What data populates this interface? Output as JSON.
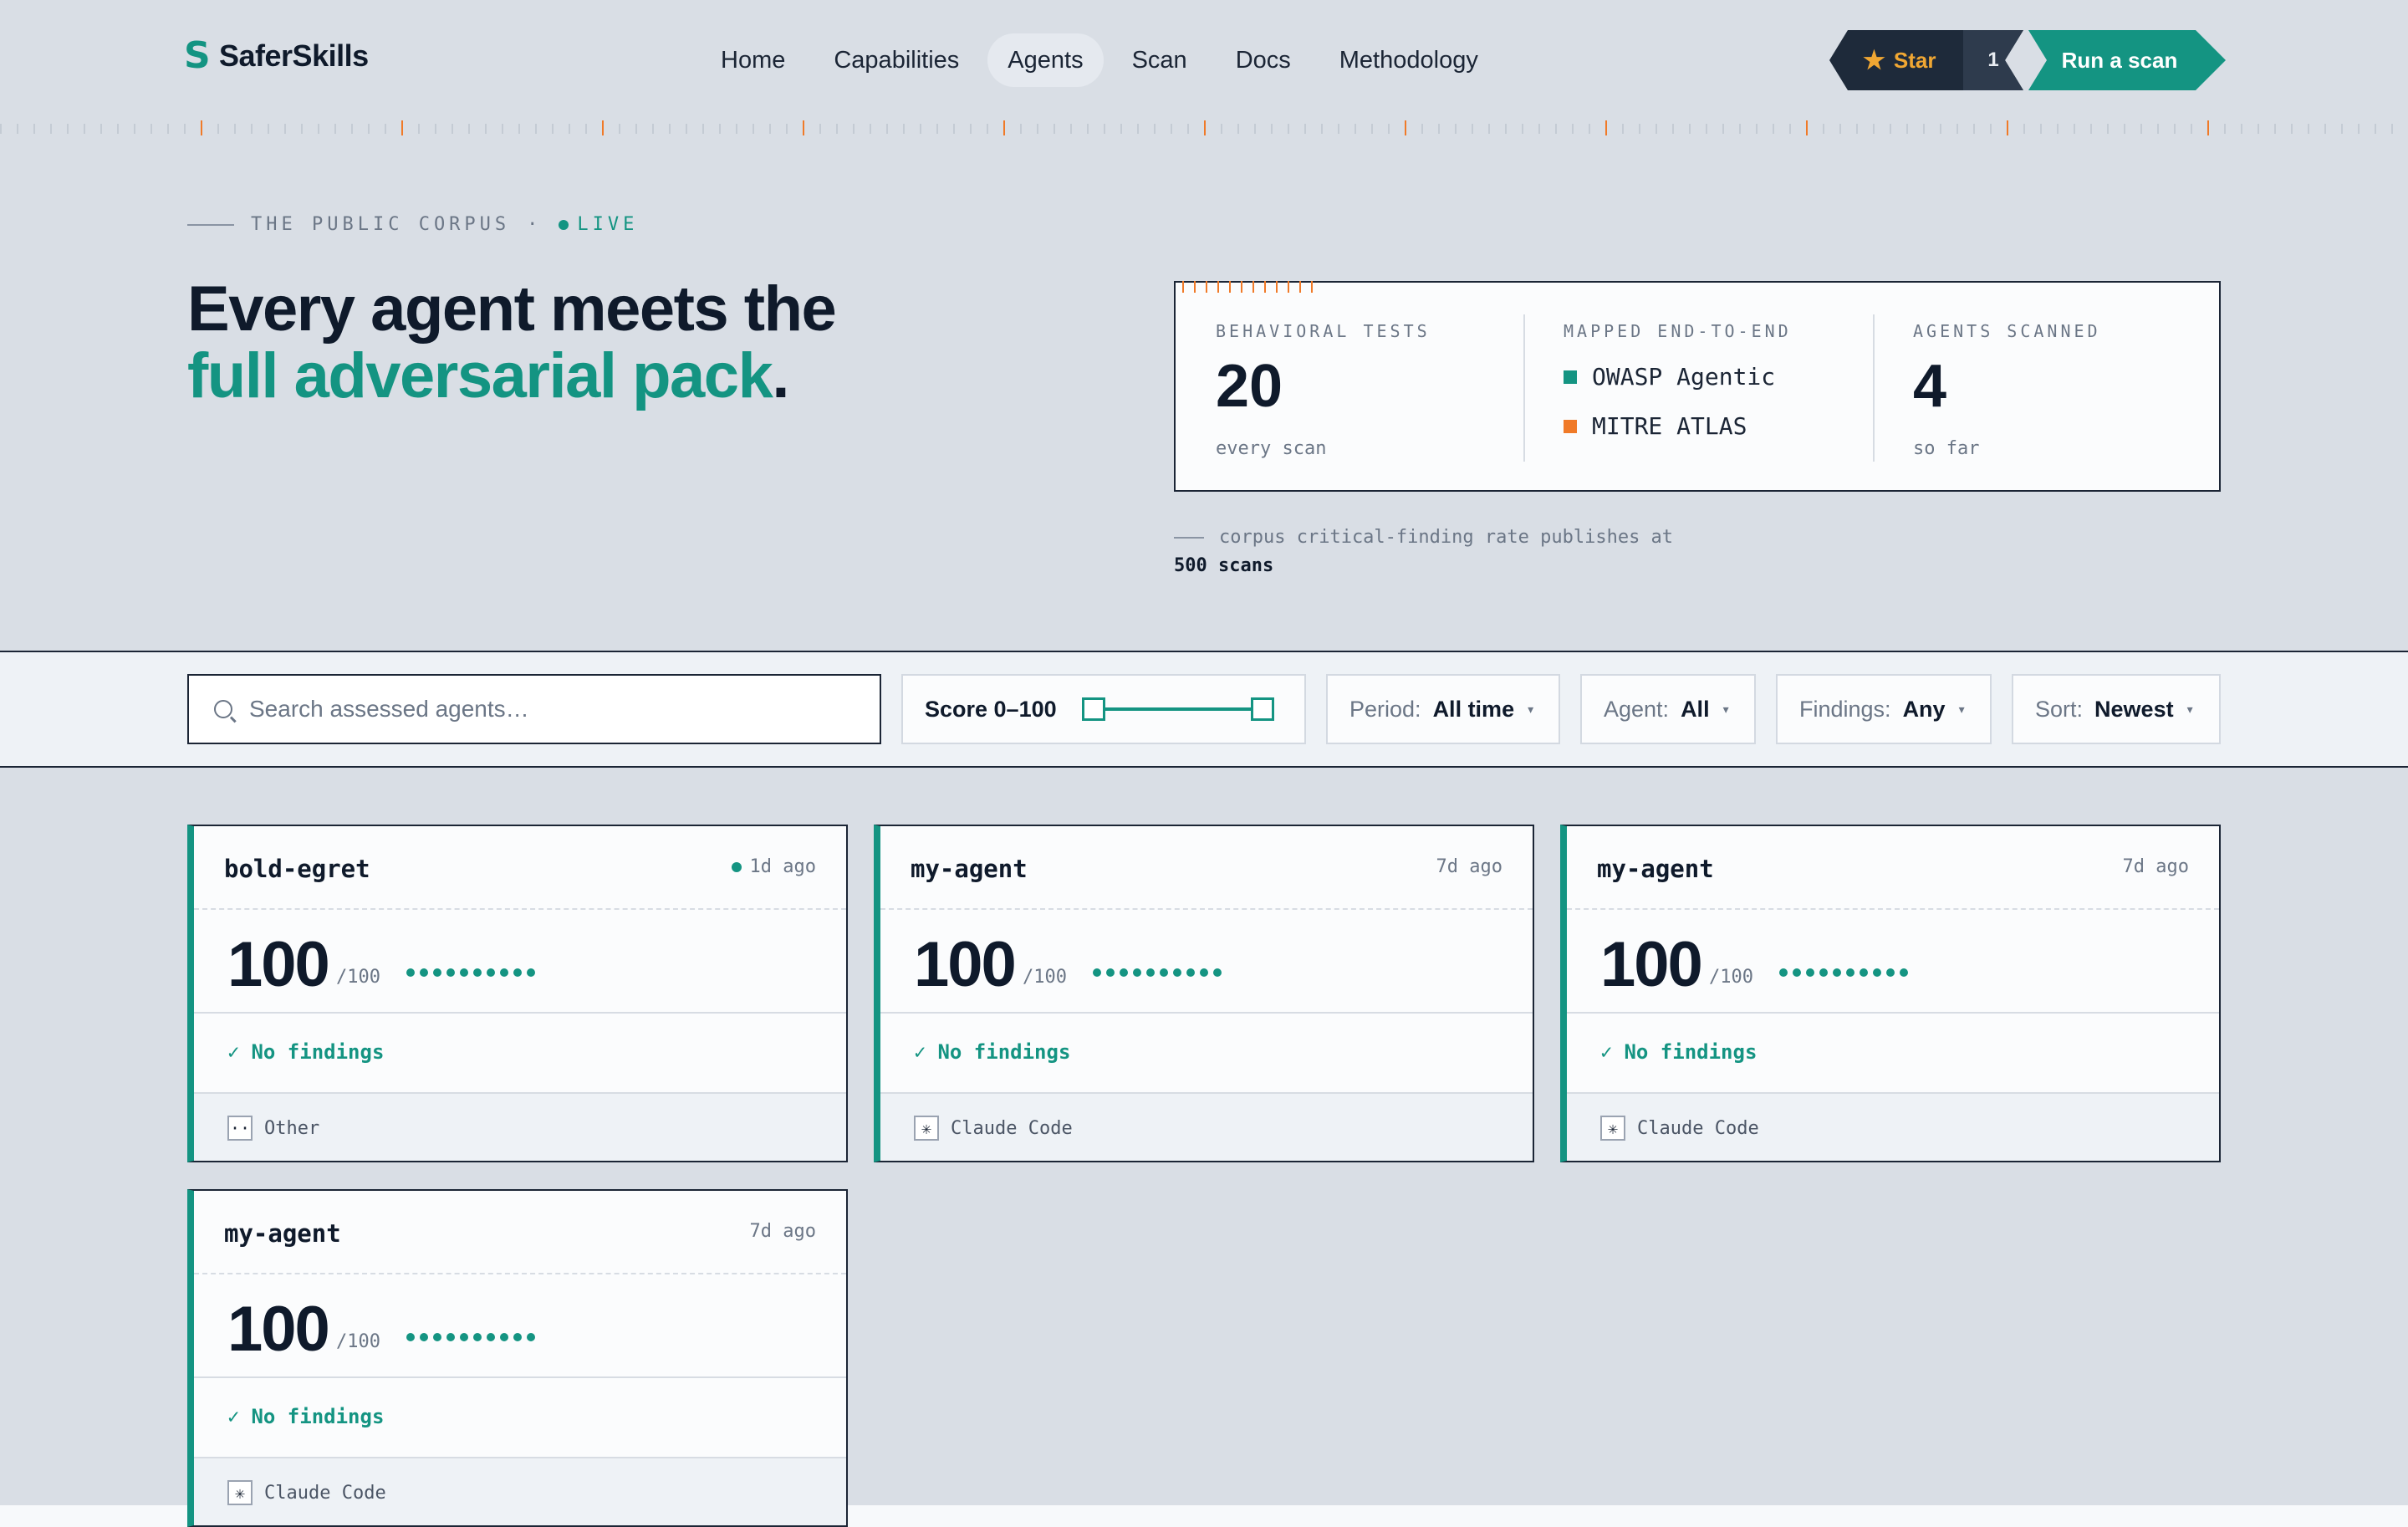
{
  "brand": {
    "logo_glyph": "S",
    "name": "SaferSkills",
    "color": "#149482"
  },
  "nav": {
    "items": [
      {
        "label": "Home",
        "active": false
      },
      {
        "label": "Capabilities",
        "active": false
      },
      {
        "label": "Agents",
        "active": true
      },
      {
        "label": "Scan",
        "active": false
      },
      {
        "label": "Docs",
        "active": false
      },
      {
        "label": "Methodology",
        "active": false
      }
    ]
  },
  "header": {
    "star_label": "Star",
    "star_icon": "star-icon",
    "star_count": "1",
    "run_label": "Run a scan"
  },
  "hero": {
    "eyebrow": "THE PUBLIC CORPUS",
    "eyebrow_sep": "·",
    "live_label": "LIVE",
    "title_line1": "Every agent meets the",
    "title_accent": "full adversarial pack",
    "title_end": "."
  },
  "stats": {
    "tests_label": "BEHAVIORAL TESTS",
    "tests_value": "20",
    "tests_sub": "every scan",
    "mapped_label": "MAPPED END-TO-END",
    "mapped_items": [
      {
        "label": "OWASP Agentic",
        "color": "#149482"
      },
      {
        "label": "MITRE ATLAS",
        "color": "#f07a28"
      }
    ],
    "agents_label": "AGENTS SCANNED",
    "agents_value": "4",
    "agents_sub": "so far"
  },
  "corpus_note": {
    "text": "corpus critical-finding rate publishes at",
    "highlight": "500 scans"
  },
  "filters": {
    "search_placeholder": "Search assessed agents…",
    "score_label": "Score 0–100",
    "score_range": [
      0,
      100
    ],
    "period_label": "Period:",
    "period_value": "All time",
    "agent_label": "Agent:",
    "agent_value": "All",
    "findings_label": "Findings:",
    "findings_value": "Any",
    "sort_label": "Sort:",
    "sort_value": "Newest"
  },
  "cards": [
    {
      "name": "bold-egret",
      "time": "1d ago",
      "live": true,
      "score": "100",
      "max": "/100",
      "findings": "No findings",
      "check": "✓",
      "agent": "Other",
      "agent_icon": "··"
    },
    {
      "name": "my-agent",
      "time": "7d ago",
      "live": false,
      "score": "100",
      "max": "/100",
      "findings": "No findings",
      "check": "✓",
      "agent": "Claude Code",
      "agent_icon": "✳"
    },
    {
      "name": "my-agent",
      "time": "7d ago",
      "live": false,
      "score": "100",
      "max": "/100",
      "findings": "No findings",
      "check": "✓",
      "agent": "Claude Code",
      "agent_icon": "✳"
    },
    {
      "name": "my-agent",
      "time": "7d ago",
      "live": false,
      "score": "100",
      "max": "/100",
      "findings": "No findings",
      "check": "✓",
      "agent": "Claude Code",
      "agent_icon": "✳"
    }
  ]
}
